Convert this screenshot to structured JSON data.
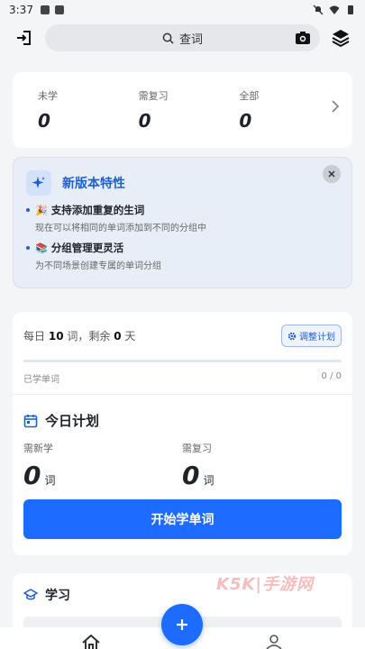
{
  "status_bar": {
    "time": "3:37"
  },
  "search": {
    "placeholder": "查词"
  },
  "stats": [
    {
      "label": "未学",
      "value": "0"
    },
    {
      "label": "需复习",
      "value": "0"
    },
    {
      "label": "全部",
      "value": "0"
    }
  ],
  "features": {
    "title": "新版本特性",
    "items": [
      {
        "emoji": "🎉",
        "title": "支持添加重复的生词",
        "desc": "现在可以将相同的单词添加到不同的分组中"
      },
      {
        "emoji": "📚",
        "title": "分组管理更灵活",
        "desc": "为不同场景创建专属的单词分组"
      }
    ]
  },
  "plan": {
    "daily_prefix": "每日",
    "daily_count": "10",
    "daily_mid": "词，剩余",
    "days_left": "0",
    "daily_suffix": "天",
    "adjust_label": "调整计划",
    "learned_label": "已学单词",
    "learned_value": "0 / 0",
    "progress": 0,
    "today_title": "今日计划",
    "new_label": "需新学",
    "new_value": "0",
    "review_label": "需复习",
    "review_value": "0",
    "unit": "词",
    "start_label": "开始学单词"
  },
  "study": {
    "title": "学习"
  },
  "watermark": "K5K|手游网",
  "colors": {
    "accent": "#1e6bff",
    "feature_title": "#1f5fcf",
    "feature_bg": "#e8eef8"
  }
}
